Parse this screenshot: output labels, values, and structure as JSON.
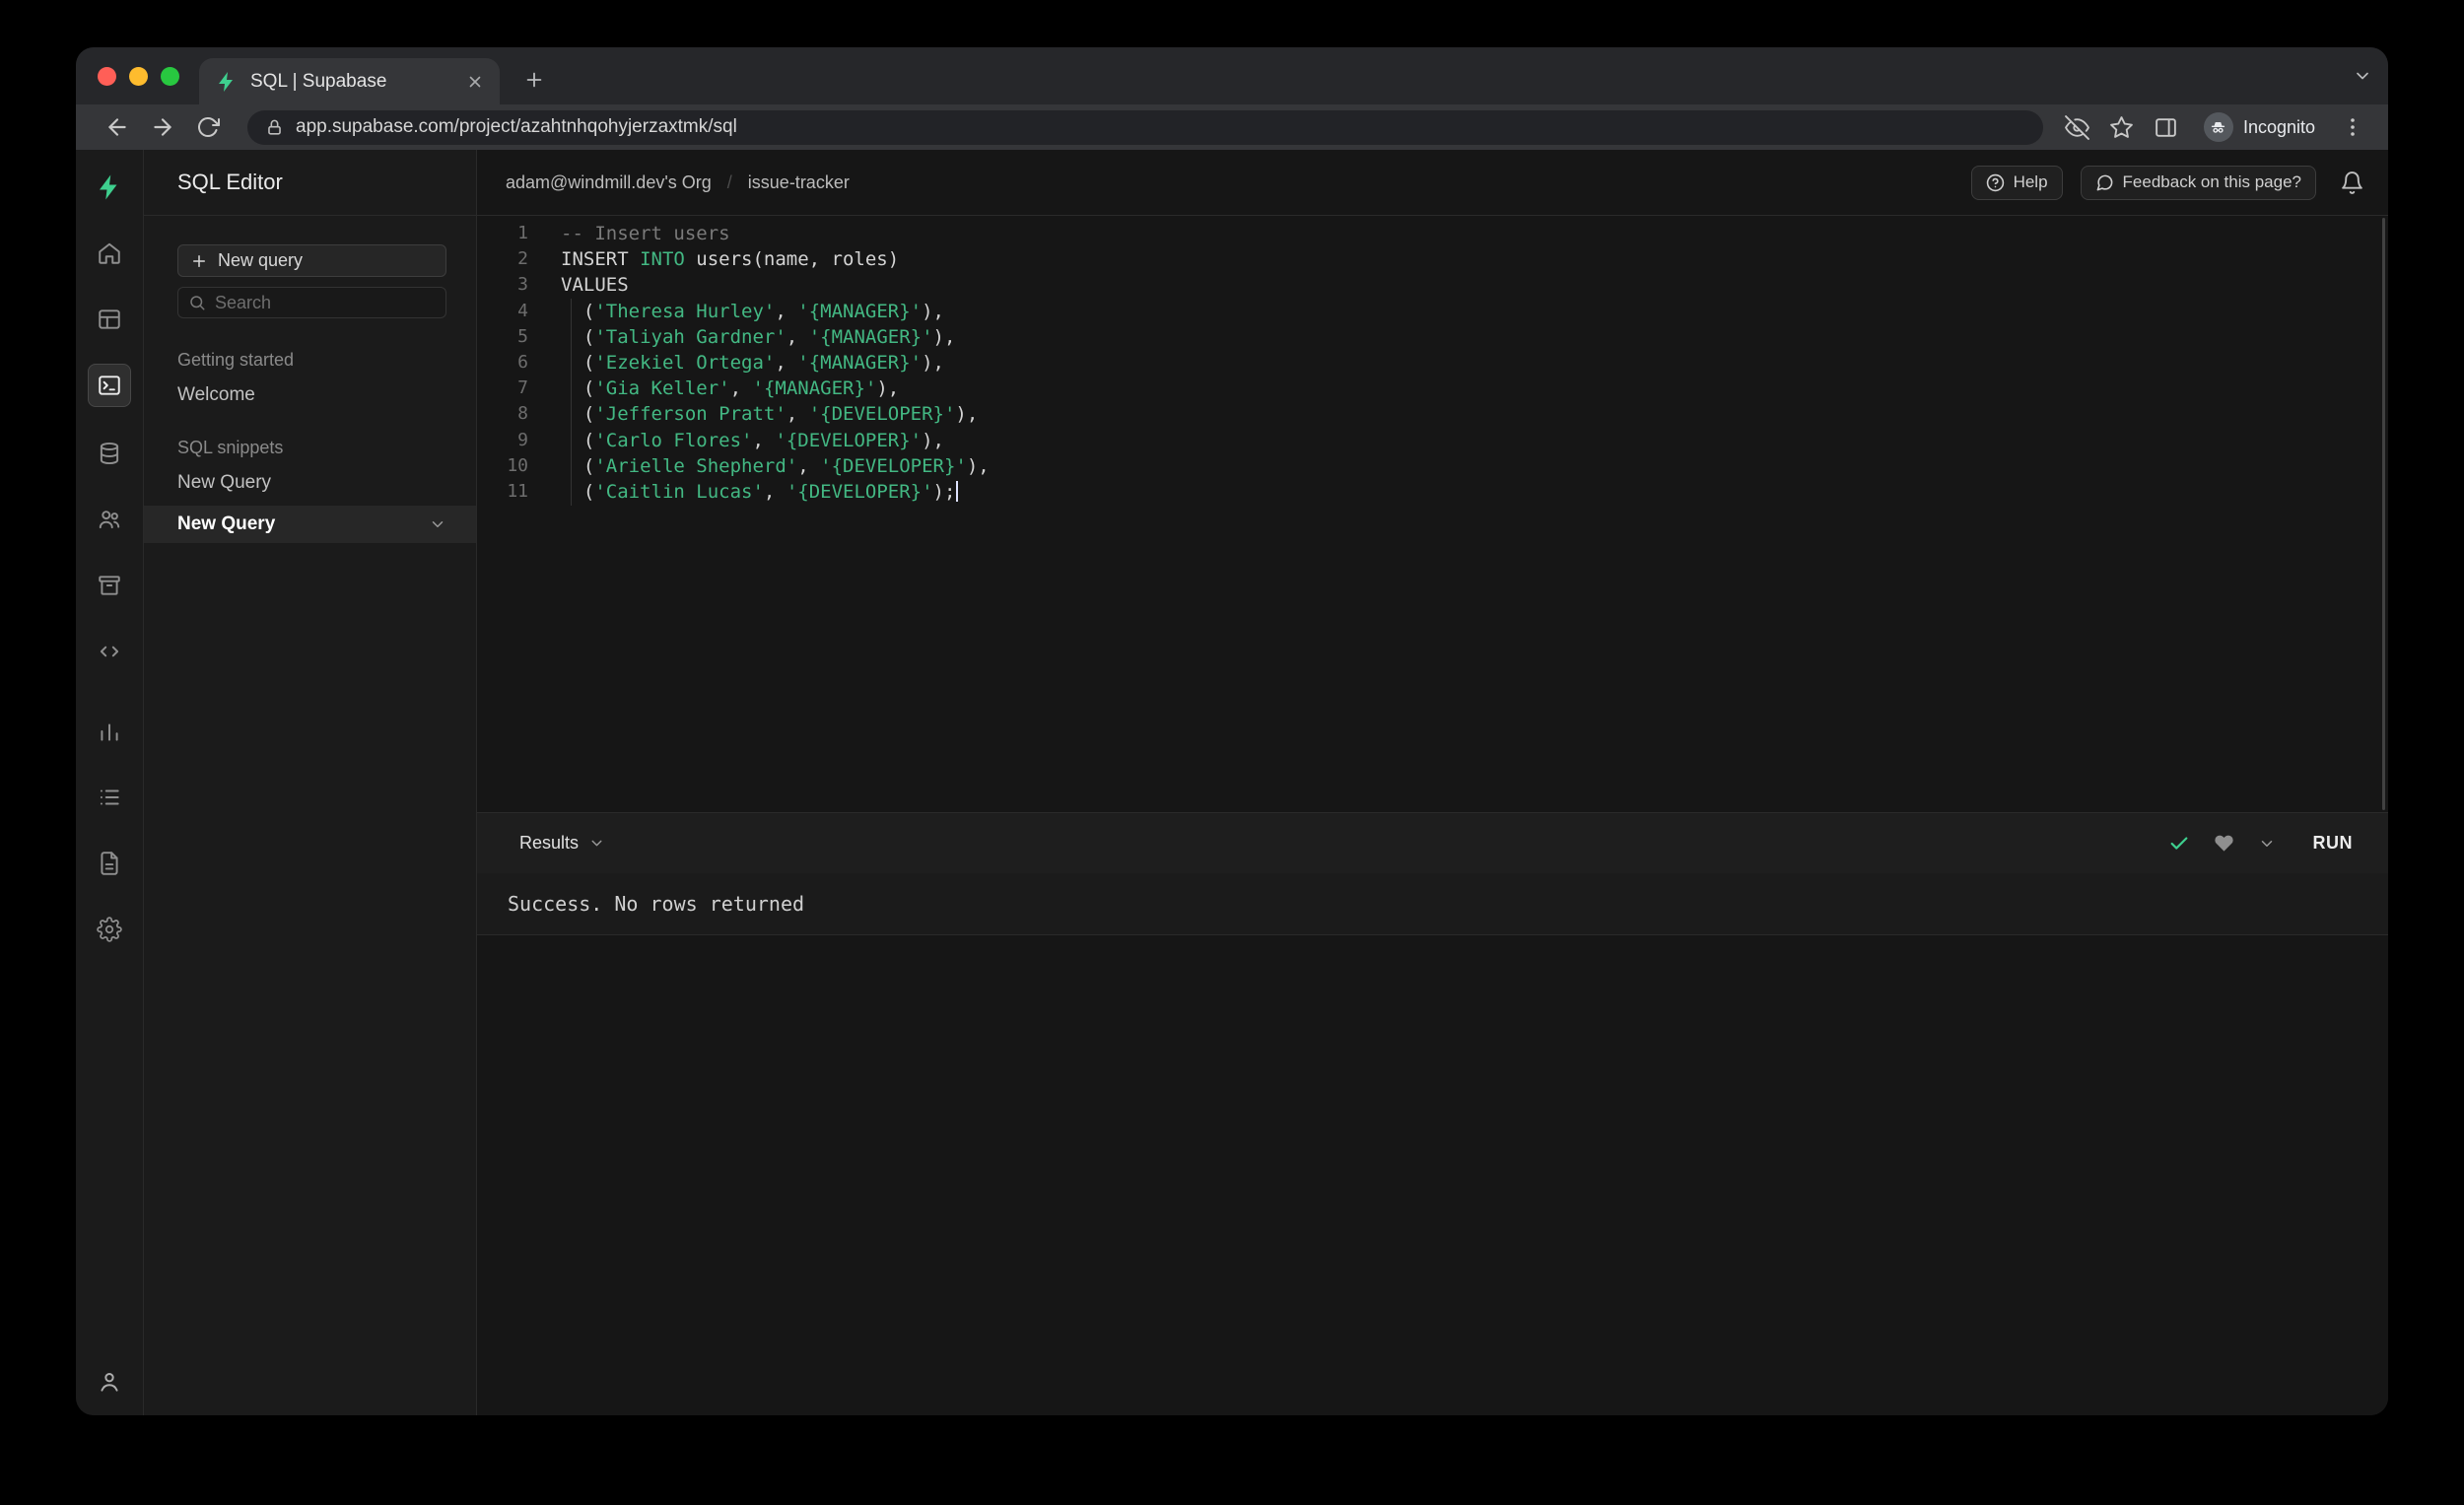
{
  "browser": {
    "tab_title": "SQL | Supabase",
    "url": "app.supabase.com/project/azahtnhqohyjerzaxtmk/sql",
    "incognito_label": "Incognito"
  },
  "sidebar": {
    "title": "SQL Editor",
    "new_query_button": "New query",
    "search_placeholder": "Search",
    "section_getting_started": "Getting started",
    "item_welcome": "Welcome",
    "section_sql_snippets": "SQL snippets",
    "item_new_query_1": "New Query",
    "item_new_query_2": "New Query"
  },
  "header": {
    "org": "adam@windmill.dev's Org",
    "separator": "/",
    "project": "issue-tracker",
    "help": "Help",
    "feedback": "Feedback on this page?"
  },
  "editor": {
    "lines": [
      {
        "n": "1",
        "seg": [
          [
            "comment",
            "-- Insert users"
          ]
        ]
      },
      {
        "n": "2",
        "seg": [
          [
            "plain",
            "INSERT "
          ],
          [
            "keyword",
            "INTO"
          ],
          [
            "plain",
            " users(name, roles)"
          ]
        ]
      },
      {
        "n": "3",
        "seg": [
          [
            "plain",
            "VALUES"
          ]
        ]
      },
      {
        "n": "4",
        "seg": [
          [
            "plain",
            "  ("
          ],
          [
            "string",
            "'Theresa Hurley'"
          ],
          [
            "plain",
            ", "
          ],
          [
            "string",
            "'{MANAGER}'"
          ],
          [
            "plain",
            "),"
          ]
        ]
      },
      {
        "n": "5",
        "seg": [
          [
            "plain",
            "  ("
          ],
          [
            "string",
            "'Taliyah Gardner'"
          ],
          [
            "plain",
            ", "
          ],
          [
            "string",
            "'{MANAGER}'"
          ],
          [
            "plain",
            "),"
          ]
        ]
      },
      {
        "n": "6",
        "seg": [
          [
            "plain",
            "  ("
          ],
          [
            "string",
            "'Ezekiel Ortega'"
          ],
          [
            "plain",
            ", "
          ],
          [
            "string",
            "'{MANAGER}'"
          ],
          [
            "plain",
            "),"
          ]
        ]
      },
      {
        "n": "7",
        "seg": [
          [
            "plain",
            "  ("
          ],
          [
            "string",
            "'Gia Keller'"
          ],
          [
            "plain",
            ", "
          ],
          [
            "string",
            "'{MANAGER}'"
          ],
          [
            "plain",
            "),"
          ]
        ]
      },
      {
        "n": "8",
        "seg": [
          [
            "plain",
            "  ("
          ],
          [
            "string",
            "'Jefferson Pratt'"
          ],
          [
            "plain",
            ", "
          ],
          [
            "string",
            "'{DEVELOPER}'"
          ],
          [
            "plain",
            "),"
          ]
        ]
      },
      {
        "n": "9",
        "seg": [
          [
            "plain",
            "  ("
          ],
          [
            "string",
            "'Carlo Flores'"
          ],
          [
            "plain",
            ", "
          ],
          [
            "string",
            "'{DEVELOPER}'"
          ],
          [
            "plain",
            "),"
          ]
        ]
      },
      {
        "n": "10",
        "seg": [
          [
            "plain",
            "  ("
          ],
          [
            "string",
            "'Arielle Shepherd'"
          ],
          [
            "plain",
            ", "
          ],
          [
            "string",
            "'{DEVELOPER}'"
          ],
          [
            "plain",
            "),"
          ]
        ]
      },
      {
        "n": "11",
        "seg": [
          [
            "plain",
            "  ("
          ],
          [
            "string",
            "'Caitlin Lucas'"
          ],
          [
            "plain",
            ", "
          ],
          [
            "string",
            "'{DEVELOPER}'"
          ],
          [
            "plain",
            ");"
          ]
        ],
        "cursor": true
      }
    ]
  },
  "results": {
    "label": "Results",
    "run": "RUN",
    "message": "Success. No rows returned"
  },
  "colors": {
    "accent_green": "#3ecf8e",
    "code_plain": "#d4d4d4",
    "code_string": "#43b883",
    "code_keyword": "#43b883",
    "code_comment": "#7a7a7a"
  }
}
